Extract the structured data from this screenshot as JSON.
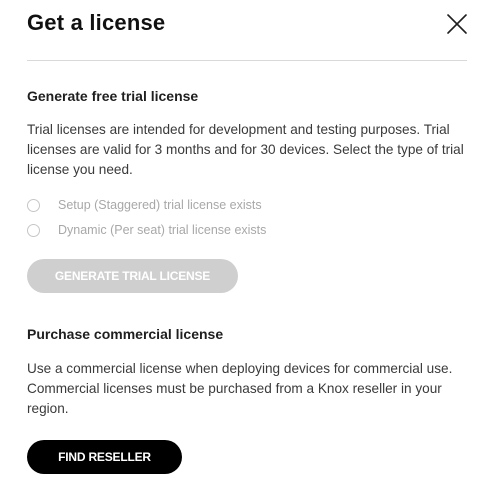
{
  "dialog": {
    "title": "Get a license",
    "close_icon": "close-icon"
  },
  "trial": {
    "heading": "Generate free trial license",
    "description": "Trial licenses are intended for development and testing purposes. Trial licenses are valid for 3 months and for 30 devices. Select the type of trial license you need.",
    "options": [
      {
        "label": "Setup (Staggered) trial license exists",
        "selected": false,
        "disabled": true
      },
      {
        "label": "Dynamic (Per seat) trial license exists",
        "selected": false,
        "disabled": true
      }
    ],
    "button_label": "GENERATE TRIAL LICENSE",
    "button_disabled": true
  },
  "commercial": {
    "heading": "Purchase commercial license",
    "description": "Use a commercial license when deploying devices for commercial use. Commercial licenses must be purchased from a Knox reseller in your region.",
    "button_label": "FIND RESELLER"
  },
  "colors": {
    "primary_button": "#000000",
    "disabled_button": "#cfcfcf",
    "disabled_text": "#a8a8a8",
    "divider": "#d9d9d9"
  }
}
